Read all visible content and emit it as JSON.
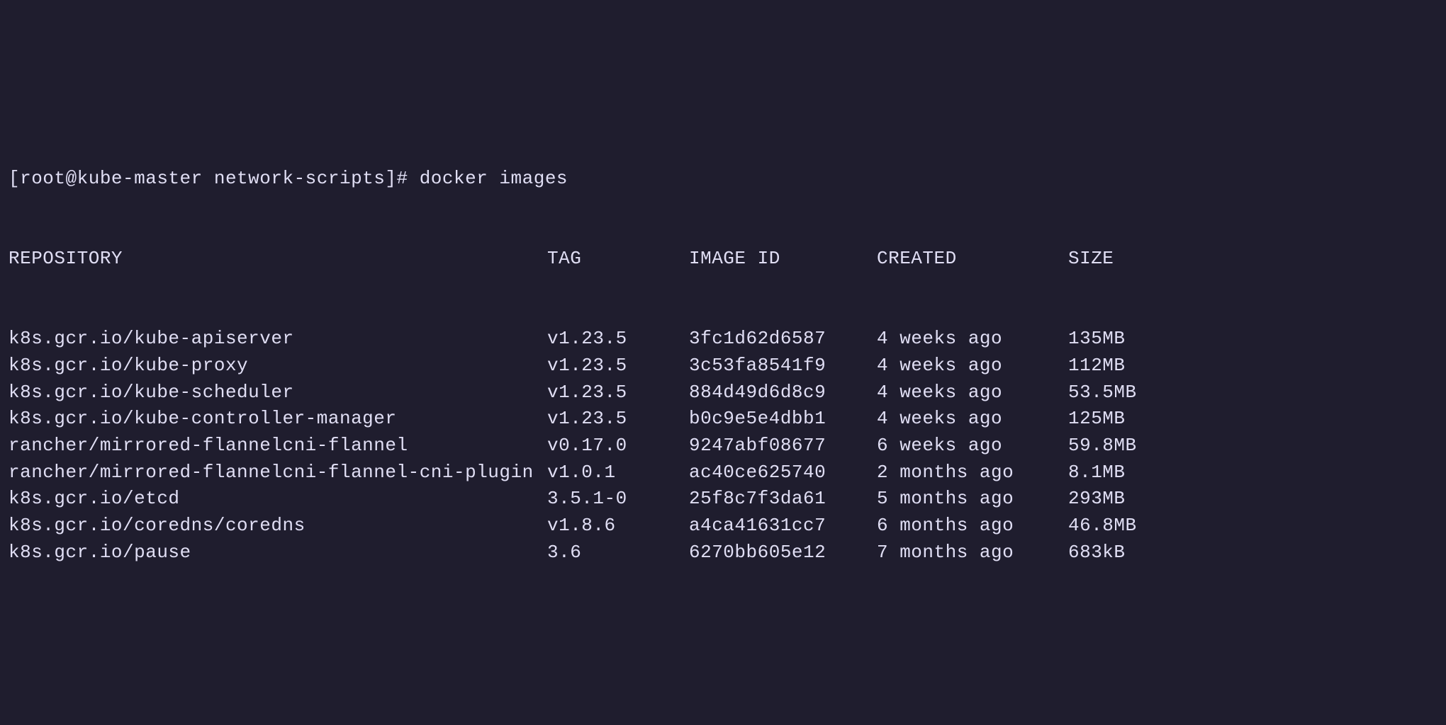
{
  "prompt": {
    "user_host": "[root@kube-master network-scripts]# ",
    "command": "docker images"
  },
  "headers": {
    "repository": "REPOSITORY",
    "tag": "TAG",
    "image_id": "IMAGE ID",
    "created": "CREATED",
    "size": "SIZE"
  },
  "rows": [
    {
      "repository": "k8s.gcr.io/kube-apiserver",
      "tag": "v1.23.5",
      "image_id": "3fc1d62d6587",
      "created": "4 weeks ago",
      "size": "135MB"
    },
    {
      "repository": "k8s.gcr.io/kube-proxy",
      "tag": "v1.23.5",
      "image_id": "3c53fa8541f9",
      "created": "4 weeks ago",
      "size": "112MB"
    },
    {
      "repository": "k8s.gcr.io/kube-scheduler",
      "tag": "v1.23.5",
      "image_id": "884d49d6d8c9",
      "created": "4 weeks ago",
      "size": "53.5MB"
    },
    {
      "repository": "k8s.gcr.io/kube-controller-manager",
      "tag": "v1.23.5",
      "image_id": "b0c9e5e4dbb1",
      "created": "4 weeks ago",
      "size": "125MB"
    },
    {
      "repository": "rancher/mirrored-flannelcni-flannel",
      "tag": "v0.17.0",
      "image_id": "9247abf08677",
      "created": "6 weeks ago",
      "size": "59.8MB"
    },
    {
      "repository": "rancher/mirrored-flannelcni-flannel-cni-plugin",
      "tag": "v1.0.1",
      "image_id": "ac40ce625740",
      "created": "2 months ago",
      "size": "8.1MB"
    },
    {
      "repository": "k8s.gcr.io/etcd",
      "tag": "3.5.1-0",
      "image_id": "25f8c7f3da61",
      "created": "5 months ago",
      "size": "293MB"
    },
    {
      "repository": "k8s.gcr.io/coredns/coredns",
      "tag": "v1.8.6",
      "image_id": "a4ca41631cc7",
      "created": "6 months ago",
      "size": "46.8MB"
    },
    {
      "repository": "k8s.gcr.io/pause",
      "tag": "3.6",
      "image_id": "6270bb605e12",
      "created": "7 months ago",
      "size": "683kB"
    }
  ]
}
